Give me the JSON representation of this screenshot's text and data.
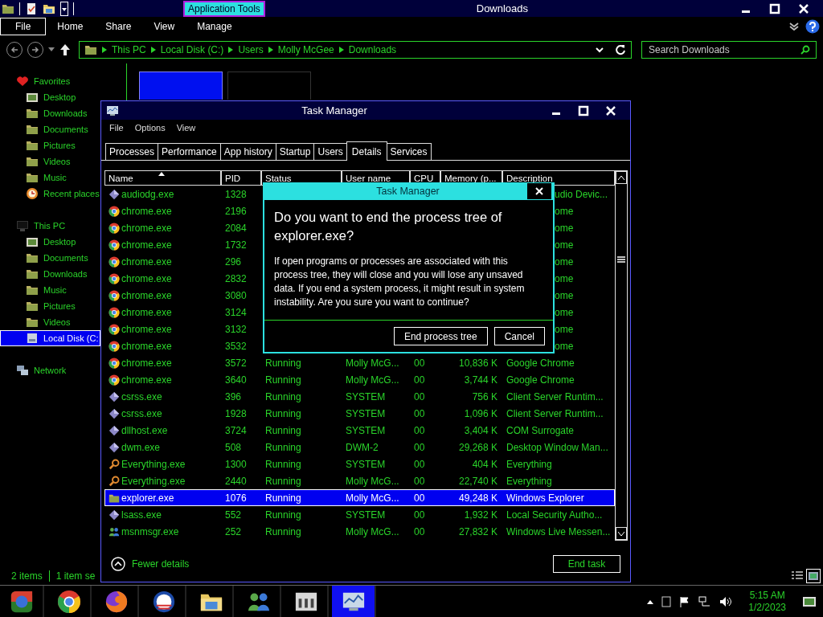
{
  "explorer": {
    "title": "Downloads",
    "context_tab": "Application Tools",
    "ribbon_tabs": [
      {
        "label": "File",
        "kind": "file"
      },
      {
        "label": "Home",
        "kind": "tab"
      },
      {
        "label": "Share",
        "kind": "tab"
      },
      {
        "label": "View",
        "kind": "tab"
      },
      {
        "label": "Manage",
        "kind": "tab"
      }
    ],
    "breadcrumb": [
      "This PC",
      "Local Disk (C:)",
      "Users",
      "Molly McGee",
      "Downloads"
    ],
    "search": {
      "placeholder": "Search Downloads"
    },
    "sidebar": [
      {
        "label": "Favorites",
        "kind": "heart",
        "selected": false,
        "children": [
          {
            "label": "Desktop",
            "kind": "desktop",
            "selected": false
          },
          {
            "label": "Downloads",
            "kind": "folder",
            "selected": false
          },
          {
            "label": "Documents",
            "kind": "folder",
            "selected": false
          },
          {
            "label": "Pictures",
            "kind": "folder",
            "selected": false
          },
          {
            "label": "Videos",
            "kind": "folder",
            "selected": false
          },
          {
            "label": "Music",
            "kind": "folder",
            "selected": false
          },
          {
            "label": "Recent places",
            "kind": "clock",
            "selected": false
          }
        ]
      },
      {
        "label": "This PC",
        "kind": "monitor",
        "selected": false,
        "children": [
          {
            "label": "Desktop",
            "kind": "desktop",
            "selected": false
          },
          {
            "label": "Documents",
            "kind": "folder",
            "selected": false
          },
          {
            "label": "Downloads",
            "kind": "folder",
            "selected": false
          },
          {
            "label": "Music",
            "kind": "folder",
            "selected": false
          },
          {
            "label": "Pictures",
            "kind": "folder",
            "selected": false
          },
          {
            "label": "Videos",
            "kind": "folder",
            "selected": false
          },
          {
            "label": "Local Disk (C:",
            "kind": "drive",
            "selected": true
          }
        ]
      },
      {
        "label": "Network",
        "kind": "network",
        "selected": false
      }
    ],
    "files": [
      {
        "selected": true
      },
      {
        "selected": false
      }
    ],
    "status": [
      "2 items",
      "1 item se"
    ],
    "views": [
      {
        "selected": false
      },
      {
        "selected": true
      }
    ]
  },
  "task_manager": {
    "title": "Task Manager",
    "menu": [
      "File",
      "Options",
      "View"
    ],
    "tabs": [
      {
        "label": "Processes",
        "selected": false
      },
      {
        "label": "Performance",
        "selected": false
      },
      {
        "label": "App history",
        "selected": false
      },
      {
        "label": "Startup",
        "selected": false
      },
      {
        "label": "Users",
        "selected": false
      },
      {
        "label": "Details",
        "selected": true
      },
      {
        "label": "Services",
        "selected": false
      }
    ],
    "columns": [
      {
        "label": "Name",
        "sorted": true
      },
      {
        "label": "PID",
        "sorted": false
      },
      {
        "label": "Status",
        "sorted": false
      },
      {
        "label": "User name",
        "sorted": false
      },
      {
        "label": "CPU",
        "sorted": false
      },
      {
        "label": "Memory (p...",
        "sorted": false
      },
      {
        "label": "Description",
        "sorted": false
      }
    ],
    "rows": [
      {
        "kind": "system",
        "name": "audiodg.exe",
        "pid": "1328",
        "covered": true,
        "description": "udio Devic...",
        "selected": false
      },
      {
        "kind": "browser",
        "name": "chrome.exe",
        "pid": "2196",
        "covered": true,
        "description": "ome",
        "selected": false
      },
      {
        "kind": "browser",
        "name": "chrome.exe",
        "pid": "2084",
        "covered": true,
        "description": "ome",
        "selected": false
      },
      {
        "kind": "browser",
        "name": "chrome.exe",
        "pid": "1732",
        "covered": true,
        "description": "ome",
        "selected": false
      },
      {
        "kind": "browser",
        "name": "chrome.exe",
        "pid": "296",
        "covered": true,
        "description": "ome",
        "selected": false
      },
      {
        "kind": "browser",
        "name": "chrome.exe",
        "pid": "2832",
        "covered": true,
        "description": "ome",
        "selected": false
      },
      {
        "kind": "browser",
        "name": "chrome.exe",
        "pid": "3080",
        "covered": true,
        "description": "ome",
        "selected": false
      },
      {
        "kind": "browser",
        "name": "chrome.exe",
        "pid": "3124",
        "covered": true,
        "description": "ome",
        "selected": false
      },
      {
        "kind": "browser",
        "name": "chrome.exe",
        "pid": "3132",
        "covered": true,
        "description": "ome",
        "selected": false
      },
      {
        "kind": "browser",
        "name": "chrome.exe",
        "pid": "3532",
        "covered": true,
        "description": "ome",
        "selected": false
      },
      {
        "kind": "browser",
        "name": "chrome.exe",
        "pid": "3572",
        "covered": false,
        "status": "Running",
        "user": "Molly McG...",
        "cpu": "00",
        "memory": "10,836 K",
        "description": "Google Chrome",
        "selected": false
      },
      {
        "kind": "browser",
        "name": "chrome.exe",
        "pid": "3640",
        "covered": false,
        "status": "Running",
        "user": "Molly McG...",
        "cpu": "00",
        "memory": "3,744 K",
        "description": "Google Chrome",
        "selected": false
      },
      {
        "kind": "system",
        "name": "csrss.exe",
        "pid": "396",
        "covered": false,
        "status": "Running",
        "user": "SYSTEM",
        "cpu": "00",
        "memory": "756 K",
        "description": "Client Server Runtim...",
        "selected": false
      },
      {
        "kind": "system",
        "name": "csrss.exe",
        "pid": "1928",
        "covered": false,
        "status": "Running",
        "user": "SYSTEM",
        "cpu": "00",
        "memory": "1,096 K",
        "description": "Client Server Runtim...",
        "selected": false
      },
      {
        "kind": "system",
        "name": "dllhost.exe",
        "pid": "3724",
        "covered": false,
        "status": "Running",
        "user": "SYSTEM",
        "cpu": "00",
        "memory": "3,404 K",
        "description": "COM Surrogate",
        "selected": false
      },
      {
        "kind": "system",
        "name": "dwm.exe",
        "pid": "508",
        "covered": false,
        "status": "Running",
        "user": "DWM-2",
        "cpu": "00",
        "memory": "29,268 K",
        "description": "Desktop Window Man...",
        "selected": false
      },
      {
        "kind": "search",
        "name": "Everything.exe",
        "pid": "1300",
        "covered": false,
        "status": "Running",
        "user": "SYSTEM",
        "cpu": "00",
        "memory": "404 K",
        "description": "Everything",
        "selected": false
      },
      {
        "kind": "search",
        "name": "Everything.exe",
        "pid": "2440",
        "covered": false,
        "status": "Running",
        "user": "Molly McG...",
        "cpu": "00",
        "memory": "22,740 K",
        "description": "Everything",
        "selected": false
      },
      {
        "kind": "folder",
        "name": "explorer.exe",
        "pid": "1076",
        "covered": false,
        "status": "Running",
        "user": "Molly McG...",
        "cpu": "00",
        "memory": "49,248 K",
        "description": "Windows Explorer",
        "selected": true
      },
      {
        "kind": "system",
        "name": "lsass.exe",
        "pid": "552",
        "covered": false,
        "status": "Running",
        "user": "SYSTEM",
        "cpu": "00",
        "memory": "1,932 K",
        "description": "Local Security Autho...",
        "selected": false
      },
      {
        "kind": "messenger",
        "name": "msnmsgr.exe",
        "pid": "252",
        "covered": false,
        "status": "Running",
        "user": "Molly McG...",
        "cpu": "00",
        "memory": "27,832 K",
        "description": "Windows Live Messen...",
        "selected": false
      }
    ],
    "footer": {
      "toggle": "Fewer details",
      "button": "End task"
    }
  },
  "dialog": {
    "title": "Task Manager",
    "heading": "Do you want to end the process tree of explorer.exe?",
    "body": "If open programs or processes are associated with this process tree, they will close and you will lose any unsaved data. If you end a system process, it might result in system instability. Are you sure you want to continue?",
    "buttons": [
      "End process tree",
      "Cancel"
    ]
  },
  "taskbar": {
    "buttons": [
      {
        "kind": "start",
        "selected": false
      },
      {
        "kind": "browser",
        "selected": false
      },
      {
        "kind": "fox",
        "selected": false
      },
      {
        "kind": "logo",
        "selected": false
      },
      {
        "kind": "files",
        "selected": false
      },
      {
        "kind": "messenger",
        "selected": false
      },
      {
        "kind": "device",
        "selected": false
      },
      {
        "kind": "taskmgr",
        "selected": true
      }
    ],
    "time": "5:15 AM",
    "date": "1/2/2023"
  }
}
